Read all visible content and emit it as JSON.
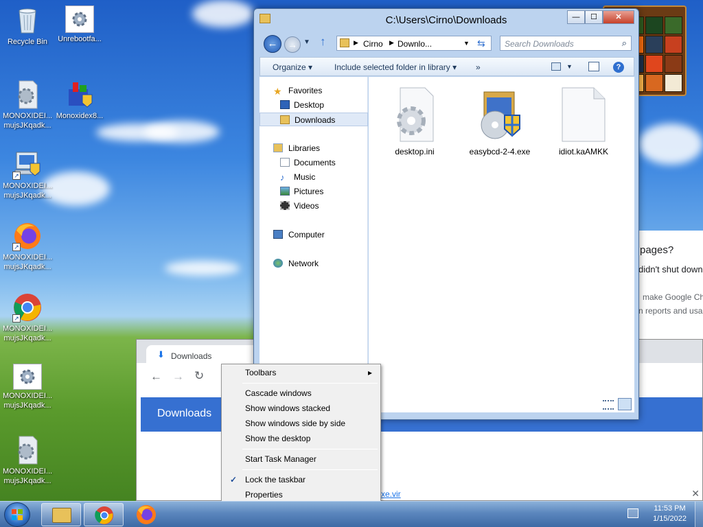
{
  "desktop": {
    "icons": [
      {
        "label": "Recycle Bin",
        "icon": "recycle-bin-icon"
      },
      {
        "label": "Unrebootfa...",
        "icon": "settings-file-icon"
      },
      {
        "label1": "MONOXIDEI...",
        "label2": "mujsJKqadk...",
        "icon": "settings-file-icon"
      },
      {
        "label": "Monoxidex8...",
        "icon": "installer-icon"
      },
      {
        "label1": "MONOXIDEI...",
        "label2": "mujsJKqadk...",
        "icon": "installer-shortcut-icon"
      },
      {
        "label1": "MONOXIDEI...",
        "label2": "mujsJKqadk...",
        "icon": "firefox-shortcut-icon"
      },
      {
        "label1": "MONOXIDEI...",
        "label2": "mujsJKqadk...",
        "icon": "chrome-shortcut-icon"
      },
      {
        "label1": "MONOXIDEI...",
        "label2": "mujsJKqadk...",
        "icon": "settings-file-icon"
      },
      {
        "label1": "MONOXIDEI...",
        "label2": "mujsJKqadk...",
        "icon": "settings-file-icon"
      }
    ]
  },
  "explorer": {
    "title": "C:\\Users\\Cirno\\Downloads",
    "minimize": "—",
    "maximize": "☐",
    "close": "✕",
    "breadcrumb": [
      "Cirno",
      "Downlo..."
    ],
    "search_placeholder": "Search Downloads",
    "commands": {
      "organize": "Organize",
      "include": "Include selected folder in library",
      "more": "»"
    },
    "nav": {
      "favorites": "Favorites",
      "desktop": "Desktop",
      "downloads": "Downloads",
      "libraries": "Libraries",
      "documents": "Documents",
      "music": "Music",
      "pictures": "Pictures",
      "videos": "Videos",
      "computer": "Computer",
      "network": "Network"
    },
    "files": [
      {
        "name": "desktop.ini",
        "icon": "settings-file-icon"
      },
      {
        "name": "easybcd-2-4.exe",
        "icon": "installer-icon"
      },
      {
        "name": "idiot.kaAMKK",
        "icon": "blank-file-icon"
      }
    ]
  },
  "chrome": {
    "tab_title": "Downloads",
    "banner_title": "Downloads",
    "download_link": "xe.vir"
  },
  "background_page": {
    "line1": "pages?",
    "line2": "didn't shut down",
    "line3": "make Google Ch",
    "line4": "n reports and usa"
  },
  "context_menu": {
    "toolbars": "Toolbars",
    "submenu_arrow": "▸",
    "cascade": "Cascade windows",
    "stacked": "Show windows stacked",
    "side_by_side": "Show windows side by side",
    "show_desktop": "Show the desktop",
    "task_manager": "Start Task Manager",
    "lock_taskbar": "Lock the taskbar",
    "lock_checked": "✓",
    "properties": "Properties"
  },
  "taskbar": {
    "time": "11:53 PM",
    "date": "1/15/2022"
  }
}
